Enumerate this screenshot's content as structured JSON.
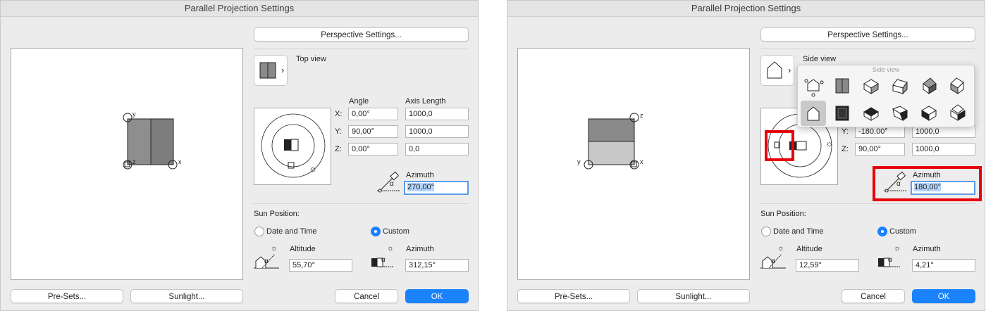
{
  "left": {
    "title": "Parallel Projection Settings",
    "perspective_button": "Perspective Settings...",
    "view_label": "Top view",
    "headers": {
      "angle": "Angle",
      "axis_length": "Axis Length"
    },
    "rows": [
      {
        "axis": "X:",
        "angle": "0,00°",
        "length": "1000,0"
      },
      {
        "axis": "Y:",
        "angle": "90,00°",
        "length": "1000,0"
      },
      {
        "axis": "Z:",
        "angle": "0,00°",
        "length": "0,0"
      }
    ],
    "azimuth_label": "Azimuth",
    "azimuth_value": "270,00°",
    "sun_position_label": "Sun Position:",
    "radio_date_time": "Date and Time",
    "radio_custom": "Custom",
    "altitude_label": "Altitude",
    "altitude_value": "55,70°",
    "sun_azimuth_label": "Azimuth",
    "sun_azimuth_value": "312,15°",
    "presets_button": "Pre-Sets...",
    "sunlight_button": "Sunlight...",
    "cancel_button": "Cancel",
    "ok_button": "OK",
    "axis_labels": {
      "a": "y",
      "b": "z",
      "c": "x"
    }
  },
  "right": {
    "title": "Parallel Projection Settings",
    "perspective_button": "Perspective Settings...",
    "view_label": "Side view",
    "popup_title": "Side view",
    "rows": [
      {
        "axis": "Y:",
        "angle": "-180,00°",
        "length": "1000,0"
      },
      {
        "axis": "Z:",
        "angle": "90,00°",
        "length": "1000,0"
      }
    ],
    "azimuth_label": "Azimuth",
    "azimuth_value": "180,00°",
    "sun_position_label": "Sun Position:",
    "radio_date_time": "Date and Time",
    "radio_custom": "Custom",
    "altitude_label": "Altitude",
    "altitude_value": "12,59°",
    "sun_azimuth_label": "Azimuth",
    "sun_azimuth_value": "4,21°",
    "presets_button": "Pre-Sets...",
    "sunlight_button": "Sunlight...",
    "cancel_button": "Cancel",
    "ok_button": "OK",
    "axis_labels": {
      "a": "z",
      "b": "y",
      "c": "x"
    }
  },
  "colors": {
    "accent": "#1a82fb",
    "highlight": "#e8000b",
    "selection": "#b4d5fe"
  },
  "icons": {
    "alpha": "α",
    "sun": "☼",
    "chevron": "›"
  },
  "state": {
    "left_selected_radio": "custom",
    "right_selected_radio": "custom"
  }
}
